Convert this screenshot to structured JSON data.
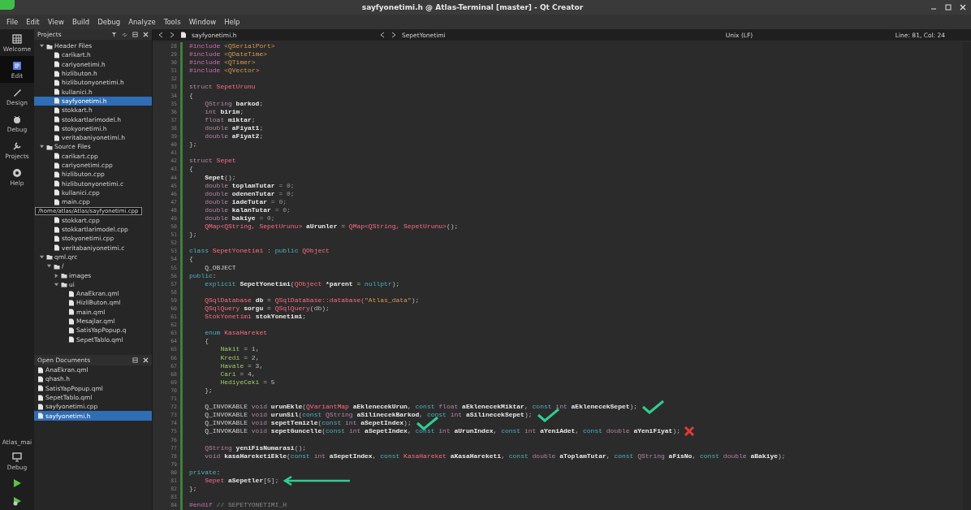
{
  "window": {
    "title": "sayfyonetimi.h @ Atlas-Terminal [master] - Qt Creator"
  },
  "menu": [
    "File",
    "Edit",
    "View",
    "Build",
    "Debug",
    "Analyze",
    "Tools",
    "Window",
    "Help"
  ],
  "modes": [
    {
      "label": "Welcome",
      "kind": "welcome",
      "selected": false
    },
    {
      "label": "Edit",
      "kind": "edit",
      "selected": true
    },
    {
      "label": "Design",
      "kind": "design",
      "selected": false
    },
    {
      "label": "Debug",
      "kind": "debug",
      "selected": false
    },
    {
      "label": "Projects",
      "kind": "projects",
      "selected": false
    },
    {
      "label": "Help",
      "kind": "help",
      "selected": false
    }
  ],
  "kit": {
    "project": "Atlas_mai",
    "build": "Debug"
  },
  "projects": {
    "title": "Projects",
    "tree": [
      {
        "label": "Header Files",
        "kind": "folder",
        "expanded": true,
        "children": [
          {
            "label": "carikart.h",
            "kind": "file",
            "selected": false
          },
          {
            "label": "cariyonetimi.h",
            "kind": "file",
            "selected": false
          },
          {
            "label": "hizlibuton.h",
            "kind": "file",
            "selected": false
          },
          {
            "label": "hizlibutonyonetimi.h",
            "kind": "file",
            "selected": false
          },
          {
            "label": "kullanici.h",
            "kind": "file",
            "selected": false
          },
          {
            "label": "sayfyonetimi.h",
            "kind": "file",
            "selected": true
          },
          {
            "label": "stokkart.h",
            "kind": "file",
            "selected": false
          },
          {
            "label": "stokkartlarimodel.h",
            "kind": "file",
            "selected": false
          },
          {
            "label": "stokyonetimi.h",
            "kind": "file",
            "selected": false
          },
          {
            "label": "veritabaniyonetimi.h",
            "kind": "file",
            "selected": false
          }
        ]
      },
      {
        "label": "Source Files",
        "kind": "folder",
        "expanded": true,
        "children": [
          {
            "label": "carikart.cpp",
            "kind": "file",
            "selected": false
          },
          {
            "label": "cariyonetimi.cpp",
            "kind": "file",
            "selected": false
          },
          {
            "label": "hizlibuton.cpp",
            "kind": "file",
            "selected": false
          },
          {
            "label": "hizlibutonyonetimi.c",
            "kind": "file",
            "selected": false
          },
          {
            "label": "kullanici.cpp",
            "kind": "file",
            "selected": false
          },
          {
            "label": "main.cpp",
            "kind": "file",
            "selected": false,
            "tooltip": "/home/atlas/Atlas/sayfyonetimi.cpp"
          },
          {
            "label": "stokkart.cpp",
            "kind": "file",
            "selected": false
          },
          {
            "label": "stokkartlarimodel.cpp",
            "kind": "file",
            "selected": false
          },
          {
            "label": "stokyonetimi.cpp",
            "kind": "file",
            "selected": false
          },
          {
            "label": "veritabaniyonetimi.c",
            "kind": "file",
            "selected": false
          }
        ]
      },
      {
        "label": "qml.qrc",
        "kind": "folder",
        "expanded": true,
        "children": [
          {
            "label": "/",
            "kind": "folder",
            "expanded": true,
            "children": [
              {
                "label": "images",
                "kind": "folder",
                "expanded": false
              },
              {
                "label": "ui",
                "kind": "folder",
                "expanded": true,
                "children": [
                  {
                    "label": "AnaEkran.qml",
                    "kind": "file",
                    "selected": false
                  },
                  {
                    "label": "HizliButon.qml",
                    "kind": "file",
                    "selected": false
                  },
                  {
                    "label": "main.qml",
                    "kind": "file",
                    "selected": false
                  },
                  {
                    "label": "Mesajlar.qml",
                    "kind": "file",
                    "selected": false
                  },
                  {
                    "label": "SatisYapPopup.q",
                    "kind": "file",
                    "selected": false
                  },
                  {
                    "label": "SepetTablo.qml",
                    "kind": "file",
                    "selected": false
                  }
                ]
              }
            ]
          }
        ]
      }
    ]
  },
  "open_documents": {
    "title": "Open Documents",
    "items": [
      {
        "label": "AnaEkran.qml",
        "selected": false
      },
      {
        "label": "qhash.h",
        "selected": false
      },
      {
        "label": "SatisYapPopup.qml",
        "selected": false
      },
      {
        "label": "SepetTablo.qml",
        "selected": false
      },
      {
        "label": "sayfyonetimi.cpp",
        "selected": false
      },
      {
        "label": "sayfyonetimi.h",
        "selected": true
      }
    ]
  },
  "editor": {
    "file": "sayfyonetimi.h",
    "symbol": "SepetYonetimi",
    "line_ending": "Unix (LF)",
    "position": "Line: 81, Col: 24",
    "lines": [
      {
        "number": "28",
        "code": [
          {
            "kind": "pp",
            "text": "#include "
          },
          {
            "kind": "str",
            "text": "<QSerialPort>"
          }
        ]
      },
      {
        "number": "29",
        "code": [
          {
            "kind": "pp",
            "text": "#include "
          },
          {
            "kind": "str",
            "text": "<QDateTime>"
          }
        ]
      },
      {
        "number": "30",
        "code": [
          {
            "kind": "pp",
            "text": "#include "
          },
          {
            "kind": "str",
            "text": "<QTimer>"
          }
        ]
      },
      {
        "number": "31",
        "code": [
          {
            "kind": "pp",
            "text": "#include "
          },
          {
            "kind": "str",
            "text": "<QVector>"
          }
        ]
      },
      {
        "number": "32"
      },
      {
        "number": "33",
        "code": [
          {
            "kind": "kw",
            "text": "struct "
          },
          {
            "kind": "type",
            "text": "SepetUrunu"
          }
        ]
      },
      {
        "number": "34",
        "code": [
          {
            "kind": "plain",
            "text": "{"
          }
        ]
      },
      {
        "number": "35",
        "code": [
          {
            "kind": "kw",
            "text": "    QString "
          },
          {
            "kind": "fld",
            "text": "barkod"
          },
          {
            "kind": "plain",
            "text": ";"
          }
        ]
      },
      {
        "number": "36",
        "code": [
          {
            "kind": "kw",
            "text": "    int "
          },
          {
            "kind": "fld",
            "text": "birim"
          },
          {
            "kind": "plain",
            "text": ";"
          }
        ]
      },
      {
        "number": "37",
        "code": [
          {
            "kind": "kw",
            "text": "    float "
          },
          {
            "kind": "fld",
            "text": "miktar"
          },
          {
            "kind": "plain",
            "text": ";"
          }
        ]
      },
      {
        "number": "38",
        "code": [
          {
            "kind": "kw",
            "text": "    double "
          },
          {
            "kind": "fld",
            "text": "aFiyat1"
          },
          {
            "kind": "plain",
            "text": ";"
          }
        ]
      },
      {
        "number": "39",
        "code": [
          {
            "kind": "kw",
            "text": "    double "
          },
          {
            "kind": "fld",
            "text": "aFiyat2"
          },
          {
            "kind": "plain",
            "text": ";"
          }
        ]
      },
      {
        "number": "40",
        "code": [
          {
            "kind": "plain",
            "text": "};"
          }
        ]
      },
      {
        "number": "41"
      },
      {
        "number": "42",
        "code": [
          {
            "kind": "kw",
            "text": "struct "
          },
          {
            "kind": "type",
            "text": "Sepet"
          }
        ]
      },
      {
        "number": "43",
        "code": [
          {
            "kind": "plain",
            "text": "{"
          }
        ]
      },
      {
        "number": "44",
        "code": [
          {
            "kind": "fld",
            "text": "    Sepet"
          },
          {
            "kind": "plain",
            "text": "();"
          }
        ]
      },
      {
        "number": "45",
        "code": [
          {
            "kind": "kw",
            "text": "    double "
          },
          {
            "kind": "fld",
            "text": "toplamTutar"
          },
          {
            "kind": "num",
            "text": " = 0;"
          }
        ]
      },
      {
        "number": "46",
        "code": [
          {
            "kind": "kw",
            "text": "    double "
          },
          {
            "kind": "fld",
            "text": "odenenTutar"
          },
          {
            "kind": "num",
            "text": " = 0;"
          }
        ]
      },
      {
        "number": "47",
        "code": [
          {
            "kind": "kw",
            "text": "    double "
          },
          {
            "kind": "fld",
            "text": "iadeTutar"
          },
          {
            "kind": "num",
            "text": " = 0;"
          }
        ]
      },
      {
        "number": "48",
        "code": [
          {
            "kind": "kw",
            "text": "    double "
          },
          {
            "kind": "fld",
            "text": "kalanTutar"
          },
          {
            "kind": "num",
            "text": " = 0;"
          }
        ]
      },
      {
        "number": "49",
        "code": [
          {
            "kind": "kw",
            "text": "    double "
          },
          {
            "kind": "fld",
            "text": "bakiye"
          },
          {
            "kind": "num",
            "text": " = 0;"
          }
        ]
      },
      {
        "number": "50",
        "code": [
          {
            "kind": "type",
            "text": "    QMap<QString, SepetUrunu> "
          },
          {
            "kind": "fld",
            "text": "aUrunler"
          },
          {
            "kind": "plain",
            "text": " = "
          },
          {
            "kind": "type",
            "text": "QMap<QString, SepetUrunu>"
          },
          {
            "kind": "plain",
            "text": "();"
          }
        ]
      },
      {
        "number": "51",
        "code": [
          {
            "kind": "plain",
            "text": "};"
          }
        ]
      },
      {
        "number": "52"
      },
      {
        "number": "53",
        "code": [
          {
            "kind": "cls",
            "text": "class "
          },
          {
            "kind": "type",
            "text": "SepetYonetimi"
          },
          {
            "kind": "plain",
            "text": " : "
          },
          {
            "kind": "cls",
            "text": "public "
          },
          {
            "kind": "type",
            "text": "QObject"
          }
        ]
      },
      {
        "number": "54",
        "code": [
          {
            "kind": "plain",
            "text": "{"
          }
        ]
      },
      {
        "number": "55",
        "code": [
          {
            "kind": "mac",
            "text": "    Q_OBJECT"
          }
        ]
      },
      {
        "number": "56",
        "code": [
          {
            "kind": "cls",
            "text": "public"
          },
          {
            "kind": "plain",
            "text": ":"
          }
        ]
      },
      {
        "number": "57",
        "code": [
          {
            "kind": "cls",
            "text": "    explicit "
          },
          {
            "kind": "fld",
            "text": "SepetYonetimi"
          },
          {
            "kind": "plain",
            "text": "("
          },
          {
            "kind": "type",
            "text": "QObject "
          },
          {
            "kind": "fld",
            "text": "*parent"
          },
          {
            "kind": "plain",
            "text": " = "
          },
          {
            "kind": "cls",
            "text": "nullptr"
          },
          {
            "kind": "plain",
            "text": ");"
          }
        ]
      },
      {
        "number": "58"
      },
      {
        "number": "59",
        "code": [
          {
            "kind": "type",
            "text": "    QSqlDatabase "
          },
          {
            "kind": "fld",
            "text": "db"
          },
          {
            "kind": "plain",
            "text": " = "
          },
          {
            "kind": "type",
            "text": "QSqlDatabase::database("
          },
          {
            "kind": "str",
            "text": "\"Atlas_data\""
          },
          {
            "kind": "plain",
            "text": ");"
          }
        ]
      },
      {
        "number": "60",
        "code": [
          {
            "kind": "type",
            "text": "    QSqlQuery "
          },
          {
            "kind": "fld",
            "text": "sorgu"
          },
          {
            "kind": "plain",
            "text": " = "
          },
          {
            "kind": "type",
            "text": "QSqlQuery"
          },
          {
            "kind": "plain",
            "text": "(db);"
          }
        ]
      },
      {
        "number": "61",
        "code": [
          {
            "kind": "type",
            "text": "    StokYonetimi "
          },
          {
            "kind": "fld",
            "text": "stokYonetimi"
          },
          {
            "kind": "plain",
            "text": ";"
          }
        ]
      },
      {
        "number": "62"
      },
      {
        "number": "63",
        "code": [
          {
            "kind": "cls",
            "text": "    enum "
          },
          {
            "kind": "type",
            "text": "KasaHareket"
          }
        ]
      },
      {
        "number": "64",
        "code": [
          {
            "kind": "plain",
            "text": "    {"
          }
        ]
      },
      {
        "number": "65",
        "code": [
          {
            "kind": "enumv",
            "text": "        Nakit"
          },
          {
            "kind": "plain",
            "text": " = 1,"
          }
        ]
      },
      {
        "number": "66",
        "code": [
          {
            "kind": "enumv",
            "text": "        Kredi"
          },
          {
            "kind": "plain",
            "text": " = 2,"
          }
        ]
      },
      {
        "number": "67",
        "code": [
          {
            "kind": "enumv",
            "text": "        Havale"
          },
          {
            "kind": "plain",
            "text": " = 3,"
          }
        ]
      },
      {
        "number": "68",
        "code": [
          {
            "kind": "enumv",
            "text": "        Cari"
          },
          {
            "kind": "plain",
            "text": " = 4,"
          }
        ]
      },
      {
        "number": "69",
        "code": [
          {
            "kind": "enumv",
            "text": "        HediyeCeki"
          },
          {
            "kind": "plain",
            "text": " = 5"
          }
        ]
      },
      {
        "number": "70",
        "code": [
          {
            "kind": "plain",
            "text": "    };"
          }
        ]
      },
      {
        "number": "71"
      },
      {
        "number": "72",
        "annotation": {
          "kind": "check"
        },
        "code": [
          {
            "kind": "mac",
            "text": "    Q_INVOKABLE "
          },
          {
            "kind": "kw",
            "text": "void "
          },
          {
            "kind": "fld",
            "text": "urunEkle"
          },
          {
            "kind": "plain",
            "text": "("
          },
          {
            "kind": "type",
            "text": "QVariantMap "
          },
          {
            "kind": "fld",
            "text": "aEklenecekUrun"
          },
          {
            "kind": "plain",
            "text": ", "
          },
          {
            "kind": "cls",
            "text": "const "
          },
          {
            "kind": "kw",
            "text": "float "
          },
          {
            "kind": "fld",
            "text": "aEklenecekMiktar"
          },
          {
            "kind": "plain",
            "text": ", "
          },
          {
            "kind": "cls",
            "text": "const "
          },
          {
            "kind": "kw",
            "text": "int "
          },
          {
            "kind": "fld",
            "text": "aEklenecekSepet"
          },
          {
            "kind": "plain",
            "text": ");"
          }
        ]
      },
      {
        "number": "73",
        "annotation": {
          "kind": "check"
        },
        "code": [
          {
            "kind": "mac",
            "text": "    Q_INVOKABLE "
          },
          {
            "kind": "kw",
            "text": "void "
          },
          {
            "kind": "fld",
            "text": "urunSil"
          },
          {
            "kind": "plain",
            "text": "("
          },
          {
            "kind": "cls",
            "text": "const "
          },
          {
            "kind": "kw",
            "text": "QString "
          },
          {
            "kind": "fld",
            "text": "aSilinecekBarkod"
          },
          {
            "kind": "plain",
            "text": ", "
          },
          {
            "kind": "cls",
            "text": "const "
          },
          {
            "kind": "kw",
            "text": "int "
          },
          {
            "kind": "fld",
            "text": "aSilinecekSepet"
          },
          {
            "kind": "plain",
            "text": ");"
          }
        ]
      },
      {
        "number": "74",
        "annotation": {
          "kind": "check"
        },
        "code": [
          {
            "kind": "mac",
            "text": "    Q_INVOKABLE "
          },
          {
            "kind": "kw",
            "text": "void "
          },
          {
            "kind": "fld",
            "text": "sepetTemizle"
          },
          {
            "kind": "plain",
            "text": "("
          },
          {
            "kind": "cls",
            "text": "const "
          },
          {
            "kind": "kw",
            "text": "int "
          },
          {
            "kind": "fld",
            "text": "aSepetIndex"
          },
          {
            "kind": "plain",
            "text": ");"
          }
        ]
      },
      {
        "number": "75",
        "annotation": {
          "kind": "cross"
        },
        "code": [
          {
            "kind": "mac",
            "text": "    Q_INVOKABLE "
          },
          {
            "kind": "kw",
            "text": "void "
          },
          {
            "kind": "fld",
            "text": "sepetGuncelle"
          },
          {
            "kind": "plain",
            "text": "("
          },
          {
            "kind": "cls",
            "text": "const "
          },
          {
            "kind": "kw",
            "text": "int "
          },
          {
            "kind": "fld",
            "text": "aSepetIndex"
          },
          {
            "kind": "plain",
            "text": ", "
          },
          {
            "kind": "cls",
            "text": "const "
          },
          {
            "kind": "kw",
            "text": "int "
          },
          {
            "kind": "fld",
            "text": "aUrunIndex"
          },
          {
            "kind": "plain",
            "text": ", "
          },
          {
            "kind": "cls",
            "text": "const "
          },
          {
            "kind": "kw",
            "text": "int "
          },
          {
            "kind": "fld",
            "text": "aYeniAdet"
          },
          {
            "kind": "plain",
            "text": ", "
          },
          {
            "kind": "cls",
            "text": "const "
          },
          {
            "kind": "kw",
            "text": "double "
          },
          {
            "kind": "fld",
            "text": "aYeniFiyat"
          },
          {
            "kind": "plain",
            "text": ");"
          }
        ]
      },
      {
        "number": "76"
      },
      {
        "number": "77",
        "code": [
          {
            "kind": "kw",
            "text": "    QString "
          },
          {
            "kind": "fld",
            "text": "yeniFisNumarasi"
          },
          {
            "kind": "plain",
            "text": "();"
          }
        ]
      },
      {
        "number": "78",
        "code": [
          {
            "kind": "kw",
            "text": "    void "
          },
          {
            "kind": "fld",
            "text": "kasaHareketiEkle"
          },
          {
            "kind": "plain",
            "text": "("
          },
          {
            "kind": "cls",
            "text": "const "
          },
          {
            "kind": "kw",
            "text": "int "
          },
          {
            "kind": "fld",
            "text": "aSepetIndex"
          },
          {
            "kind": "plain",
            "text": ", "
          },
          {
            "kind": "cls",
            "text": "const "
          },
          {
            "kind": "type",
            "text": "KasaHareket "
          },
          {
            "kind": "fld",
            "text": "aKasaHareketi"
          },
          {
            "kind": "plain",
            "text": ", "
          },
          {
            "kind": "cls",
            "text": "const "
          },
          {
            "kind": "kw",
            "text": "double "
          },
          {
            "kind": "fld",
            "text": "aToplamTutar"
          },
          {
            "kind": "plain",
            "text": ", "
          },
          {
            "kind": "cls",
            "text": "const "
          },
          {
            "kind": "kw",
            "text": "QString "
          },
          {
            "kind": "fld",
            "text": "aFisNo"
          },
          {
            "kind": "plain",
            "text": ", "
          },
          {
            "kind": "cls",
            "text": "const "
          },
          {
            "kind": "kw",
            "text": "double "
          },
          {
            "kind": "fld",
            "text": "aBakiye"
          },
          {
            "kind": "plain",
            "text": ");"
          }
        ]
      },
      {
        "number": "79"
      },
      {
        "number": "80",
        "code": [
          {
            "kind": "cls",
            "text": "private"
          },
          {
            "kind": "plain",
            "text": ":"
          }
        ]
      },
      {
        "number": "81",
        "annotation": {
          "kind": "arrow"
        },
        "code": [
          {
            "kind": "type",
            "text": "    Sepet "
          },
          {
            "kind": "fld",
            "text": "aSepetler"
          },
          {
            "kind": "plain",
            "text": "[5];"
          }
        ]
      },
      {
        "number": "82",
        "code": [
          {
            "kind": "plain",
            "text": "};"
          }
        ]
      },
      {
        "number": "83"
      },
      {
        "number": "84",
        "code": [
          {
            "kind": "pp",
            "text": "#endif "
          },
          {
            "kind": "com",
            "text": "// SEPETYONETIMI_H"
          }
        ]
      }
    ]
  }
}
